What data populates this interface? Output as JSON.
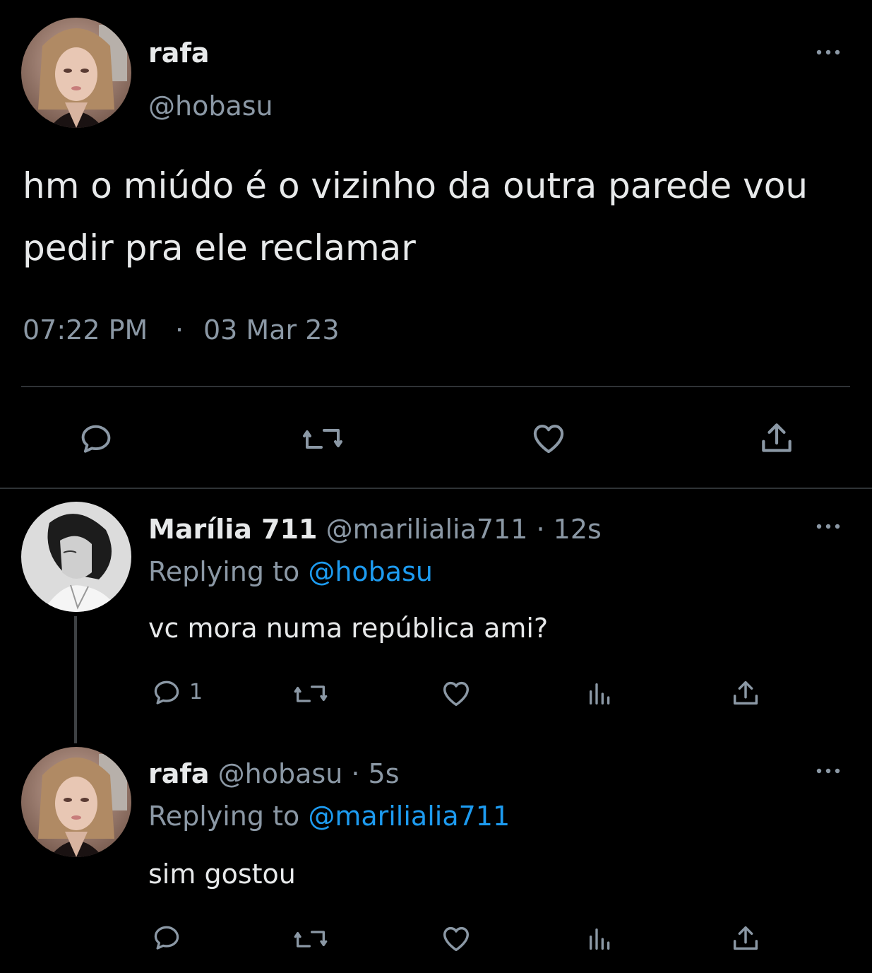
{
  "main_tweet": {
    "display_name": "rafa",
    "handle": "@hobasu",
    "text_line1": "hm o miúdo é o vizinho da outra parede vou",
    "text_line2": "pedir pra ele reclamar",
    "time": "07:22 PM",
    "separator": "·",
    "date": "03 Mar 23",
    "actions": [
      "reply-icon",
      "retweet-icon",
      "like-icon",
      "share-icon"
    ]
  },
  "replies": [
    {
      "display_name": "Marília 711",
      "handle": "@marilialia711",
      "time_suffix": "· 12s",
      "replying_prefix": "Replying to",
      "replying_to": "@hobasu",
      "text": "vc mora numa república ami?",
      "reply_count": "1",
      "actions": [
        "reply-icon",
        "retweet-icon",
        "like-icon",
        "analytics-icon",
        "share-icon"
      ]
    },
    {
      "display_name": "rafa",
      "handle": "@hobasu",
      "time_suffix": "· 5s",
      "replying_prefix": "Replying to",
      "replying_to": "@marilialia711",
      "text": "sim gostou",
      "actions": [
        "reply-icon",
        "retweet-icon",
        "like-icon",
        "analytics-icon",
        "share-icon"
      ]
    }
  ],
  "colors": {
    "background": "#000000",
    "text": "#e7e9ea",
    "muted": "#8b98a5",
    "link": "#1d9bf0",
    "divider": "#2f3336"
  }
}
